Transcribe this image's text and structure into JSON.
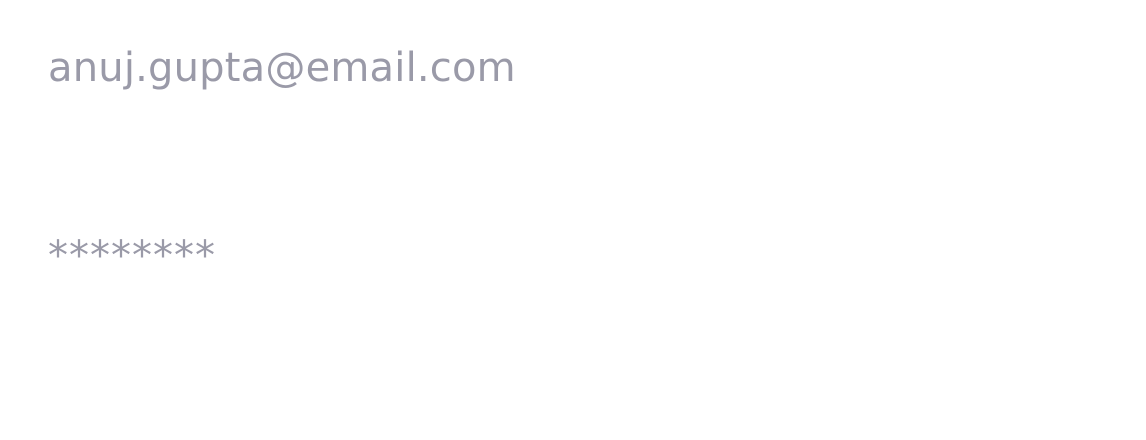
{
  "login_form": {
    "email_value": "anuj.gupta@email.com",
    "password_display": "********"
  },
  "colors": {
    "text": "#9a9aa8",
    "background": "#ffffff"
  }
}
